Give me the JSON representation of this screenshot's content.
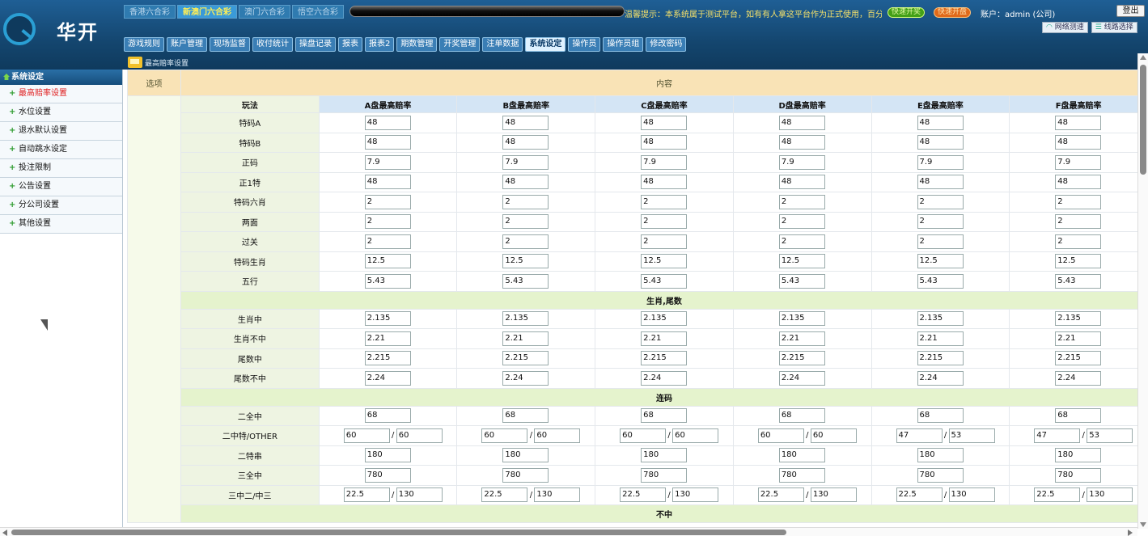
{
  "brand": "华开",
  "lottery_tabs": [
    {
      "label": "香港六合彩",
      "active": false
    },
    {
      "label": "新澳门六合彩",
      "active": true
    },
    {
      "label": "澳门六合彩",
      "active": false
    },
    {
      "label": "悟空六合彩",
      "active": false
    }
  ],
  "notice": "温馨提示：本系统属于测试平台，如有有人拿这平台作为正式使用，百分之百",
  "notice_btn1": "快速开奖",
  "notice_btn2": "快速开盘",
  "account": "账户：admin (公司)",
  "logout": "登出",
  "net_test": "网络测速",
  "line_select": "线路选择",
  "nav": [
    {
      "label": "游戏规则"
    },
    {
      "label": "账户管理"
    },
    {
      "label": "现场监督"
    },
    {
      "label": "收付统计"
    },
    {
      "label": "操盘记录"
    },
    {
      "label": "报表"
    },
    {
      "label": "报表2"
    },
    {
      "label": "期数管理"
    },
    {
      "label": "开奖管理"
    },
    {
      "label": "注单数据"
    },
    {
      "label": "系统设定",
      "active": true
    },
    {
      "label": "操作员"
    },
    {
      "label": "操作员组"
    },
    {
      "label": "修改密码"
    }
  ],
  "breadcrumb": "最高赔率设置",
  "sidebar": {
    "title": "系统设定",
    "items": [
      {
        "label": "最高赔率设置",
        "active": true
      },
      {
        "label": "水位设置"
      },
      {
        "label": "退水默认设置"
      },
      {
        "label": "自动跳水设定"
      },
      {
        "label": "投注限制"
      },
      {
        "label": "公告设置"
      },
      {
        "label": "分公司设置"
      },
      {
        "label": "其他设置"
      }
    ]
  },
  "table": {
    "option_header": "选项",
    "content_header": "内容",
    "columns": [
      "玩法",
      "A盘最高赔率",
      "B盘最高赔率",
      "C盘最高赔率",
      "D盘最高赔率",
      "E盘最高赔率",
      "F盘最高赔率"
    ],
    "sections": [
      {
        "title": "",
        "rows": [
          {
            "name": "特码A",
            "values": [
              "48",
              "48",
              "48",
              "48",
              "48",
              "48"
            ]
          },
          {
            "name": "特码B",
            "values": [
              "48",
              "48",
              "48",
              "48",
              "48",
              "48"
            ]
          },
          {
            "name": "正码",
            "values": [
              "7.9",
              "7.9",
              "7.9",
              "7.9",
              "7.9",
              "7.9"
            ]
          },
          {
            "name": "正1特",
            "values": [
              "48",
              "48",
              "48",
              "48",
              "48",
              "48"
            ]
          },
          {
            "name": "特码六肖",
            "values": [
              "2",
              "2",
              "2",
              "2",
              "2",
              "2"
            ]
          },
          {
            "name": "两面",
            "values": [
              "2",
              "2",
              "2",
              "2",
              "2",
              "2"
            ]
          },
          {
            "name": "过关",
            "values": [
              "2",
              "2",
              "2",
              "2",
              "2",
              "2"
            ]
          },
          {
            "name": "特码生肖",
            "values": [
              "12.5",
              "12.5",
              "12.5",
              "12.5",
              "12.5",
              "12.5"
            ]
          },
          {
            "name": "五行",
            "values": [
              "5.43",
              "5.43",
              "5.43",
              "5.43",
              "5.43",
              "5.43"
            ]
          }
        ]
      },
      {
        "title": "生肖,尾数",
        "rows": [
          {
            "name": "生肖中",
            "values": [
              "2.135",
              "2.135",
              "2.135",
              "2.135",
              "2.135",
              "2.135"
            ]
          },
          {
            "name": "生肖不中",
            "values": [
              "2.21",
              "2.21",
              "2.21",
              "2.21",
              "2.21",
              "2.21"
            ]
          },
          {
            "name": "尾数中",
            "values": [
              "2.215",
              "2.215",
              "2.215",
              "2.215",
              "2.215",
              "2.215"
            ]
          },
          {
            "name": "尾数不中",
            "values": [
              "2.24",
              "2.24",
              "2.24",
              "2.24",
              "2.24",
              "2.24"
            ]
          }
        ]
      },
      {
        "title": "连码",
        "rows": [
          {
            "name": "二全中",
            "values": [
              "68",
              "68",
              "68",
              "68",
              "68",
              "68"
            ]
          },
          {
            "name": "二中特/OTHER",
            "pairs": [
              [
                "60",
                "60"
              ],
              [
                "60",
                "60"
              ],
              [
                "60",
                "60"
              ],
              [
                "60",
                "60"
              ],
              [
                "47",
                "53"
              ],
              [
                "47",
                "53"
              ]
            ]
          },
          {
            "name": "二特串",
            "values": [
              "180",
              "180",
              "180",
              "180",
              "180",
              "180"
            ]
          },
          {
            "name": "三全中",
            "values": [
              "780",
              "780",
              "780",
              "780",
              "780",
              "780"
            ]
          },
          {
            "name": "三中二/中三",
            "pairs": [
              [
                "22.5",
                "130"
              ],
              [
                "22.5",
                "130"
              ],
              [
                "22.5",
                "130"
              ],
              [
                "22.5",
                "130"
              ],
              [
                "22.5",
                "130"
              ],
              [
                "22.5",
                "130"
              ]
            ]
          }
        ]
      },
      {
        "title": "不中",
        "rows": []
      }
    ]
  }
}
